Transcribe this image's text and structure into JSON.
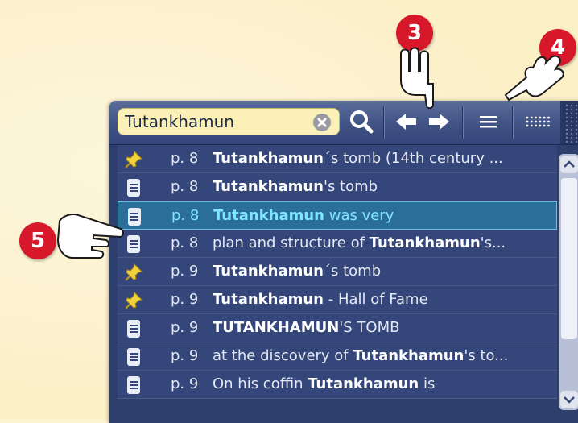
{
  "search": {
    "value": "Tutankhamun",
    "clear_icon": "clear-circle-x-icon"
  },
  "toolbar": {
    "icons": [
      "magnifier-search-icon",
      "arrow-left-icon",
      "arrow-right-icon",
      "list-lines-icon",
      "dots-grid-icon"
    ]
  },
  "results": [
    {
      "icon": "pushpin-icon",
      "page": "p. 8",
      "bold": "Tutankhamun",
      "rest": "´s tomb (14th century ...",
      "selected": false
    },
    {
      "icon": "document-icon",
      "page": "p. 8",
      "bold": "Tutankhamun",
      "rest": "'s tomb",
      "selected": false
    },
    {
      "icon": "document-icon",
      "page": "p. 8",
      "bold": "Tutankhamun",
      "rest": " was very",
      "selected": true
    },
    {
      "icon": "document-icon",
      "page": "p. 8",
      "pre": "plan and structure of ",
      "bold": "Tutankhamun",
      "rest": "'s...",
      "selected": false
    },
    {
      "icon": "pushpin-icon",
      "page": "p. 9",
      "bold": "Tutankhamun",
      "rest": "´s tomb",
      "selected": false
    },
    {
      "icon": "pushpin-icon",
      "page": "p. 9",
      "bold": "Tutankhamun",
      "rest": " - Hall of Fame",
      "selected": false
    },
    {
      "icon": "document-icon",
      "page": "p. 9",
      "bold": "TUTANKHAMUN",
      "rest": "'S TOMB",
      "selected": false
    },
    {
      "icon": "document-icon",
      "page": "p. 9",
      "pre": "at the discovery of ",
      "bold": "Tutankhamun",
      "rest": "'s to...",
      "selected": false
    },
    {
      "icon": "document-icon",
      "page": "p. 9",
      "pre": "On his coffin ",
      "bold": "Tutankhamun",
      "rest": " is",
      "selected": false
    }
  ],
  "callouts": {
    "n3": "3",
    "n4": "4",
    "n5": "5"
  },
  "colors": {
    "accent_selected": "#7fe6ff",
    "badge": "#d7182a",
    "panel": "#34467a",
    "search_bg": "#fbf0b7"
  }
}
